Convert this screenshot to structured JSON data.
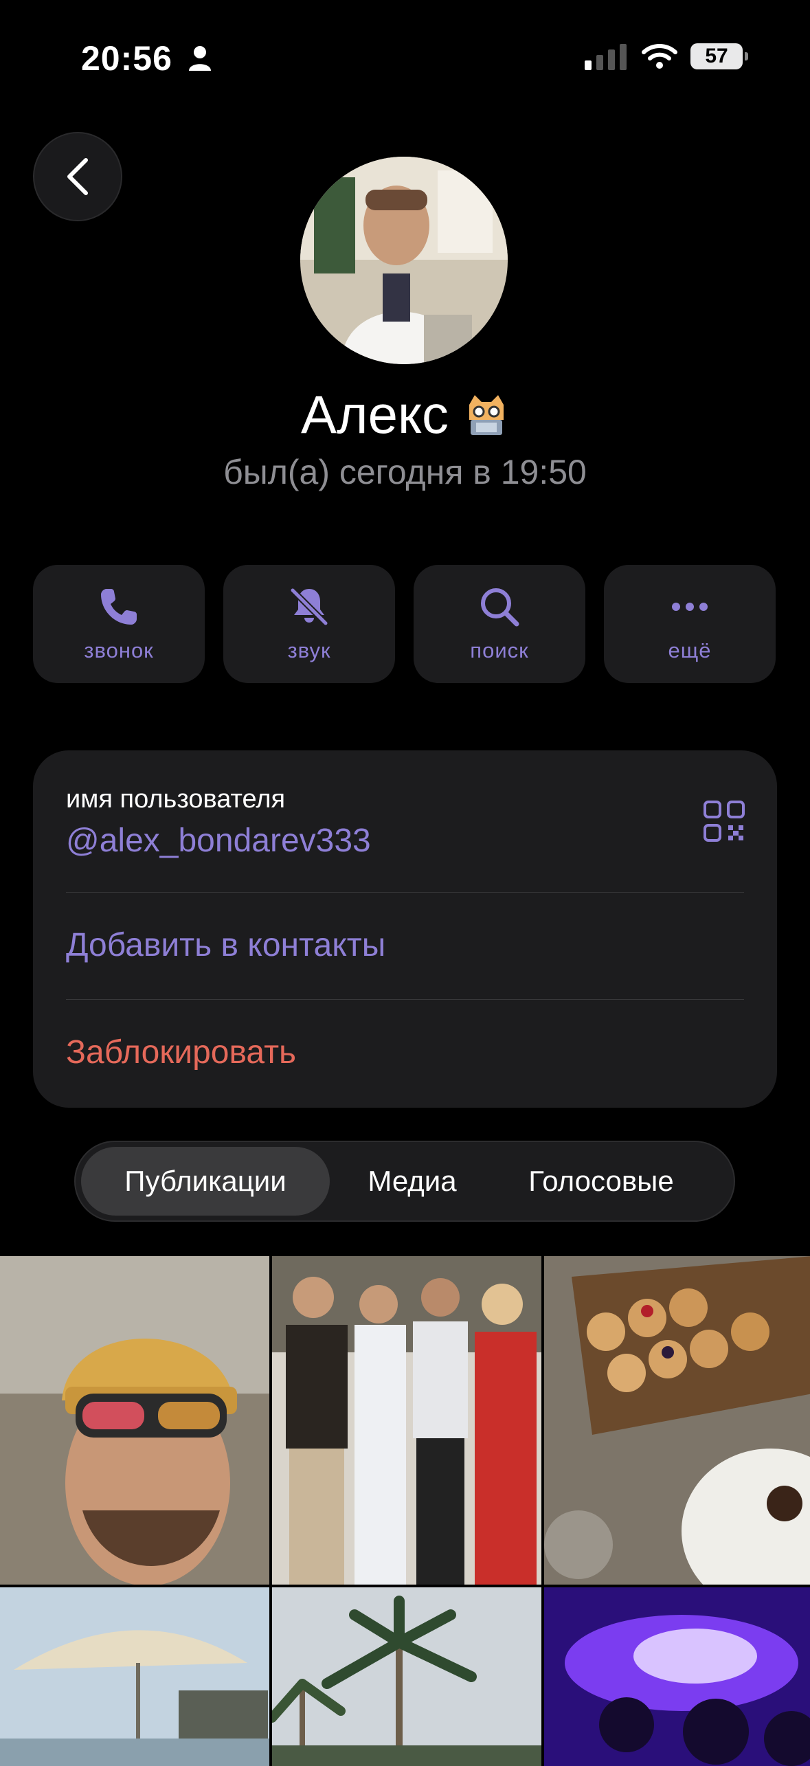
{
  "status_bar": {
    "time": "20:56",
    "battery": "57"
  },
  "profile": {
    "name": "Алекс",
    "last_seen": "был(а) сегодня в 19:50"
  },
  "actions": [
    {
      "label": "звонок",
      "icon": "phone-icon"
    },
    {
      "label": "звук",
      "icon": "bell-muted-icon"
    },
    {
      "label": "поиск",
      "icon": "search-icon"
    },
    {
      "label": "ещё",
      "icon": "more-icon"
    }
  ],
  "info": {
    "username_caption": "имя пользователя",
    "username": "@alex_bondarev333",
    "add_contact": "Добавить в контакты",
    "block": "Заблокировать"
  },
  "tabs": [
    {
      "label": "Публикации",
      "active": true
    },
    {
      "label": "Медиа",
      "active": false
    },
    {
      "label": "Голосовые",
      "active": false
    }
  ],
  "colors": {
    "accent": "#8e7fd6",
    "danger": "#e5695a",
    "card": "#1c1c1e"
  }
}
